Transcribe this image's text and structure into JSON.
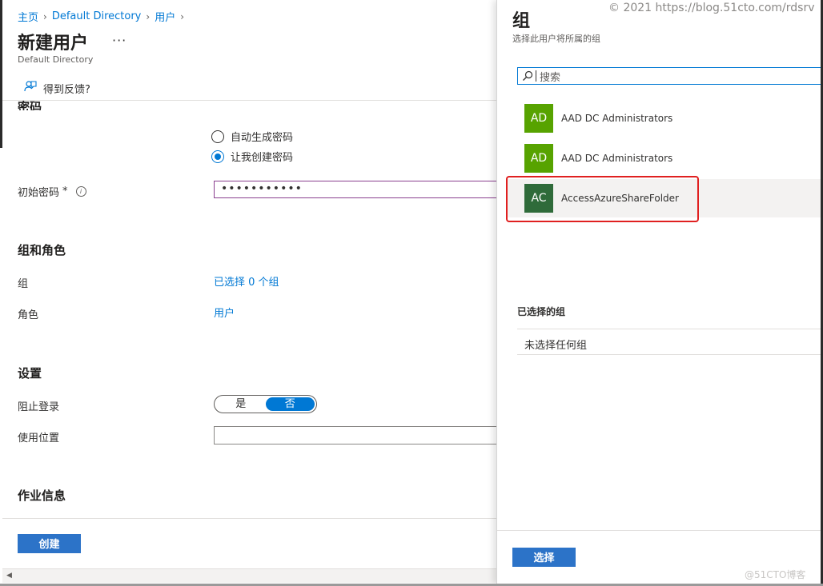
{
  "breadcrumb": [
    {
      "label": "主页"
    },
    {
      "label": "Default Directory"
    },
    {
      "label": "用户"
    }
  ],
  "page": {
    "title": "新建用户",
    "more": "···",
    "subtitle": "Default Directory",
    "feedback_label": "得到反馈?"
  },
  "password": {
    "section_title": "密码",
    "option_auto": "自动生成密码",
    "option_manual": "让我创建密码",
    "selected_option": "让我创建密码",
    "initial_label": "初始密码",
    "required_mark": "*",
    "initial_value": "•••••••••••"
  },
  "groups_roles": {
    "section_title": "组和角色",
    "groups_label": "组",
    "groups_value": "已选择 0 个组",
    "role_label": "角色",
    "role_value": "用户"
  },
  "settings": {
    "section_title": "设置",
    "block_signin_label": "阻止登录",
    "toggle_yes": "是",
    "toggle_no": "否",
    "toggle_selected": "否",
    "usage_location_label": "使用位置",
    "usage_location_value": ""
  },
  "job_info": {
    "section_title": "作业信息"
  },
  "footer": {
    "create_label": "创建"
  },
  "panel": {
    "title": "组",
    "subtitle": "选择此用户将所属的组",
    "search_placeholder": "搜索",
    "groups": [
      {
        "initials": "AD",
        "name": "AAD DC Administrators",
        "color": "#57a300"
      },
      {
        "initials": "AD",
        "name": "AAD DC Administrators",
        "color": "#57a300"
      },
      {
        "initials": "AC",
        "name": "AccessAzureShareFolder",
        "color": "#2f6b3a",
        "highlighted": true
      }
    ],
    "selected_title": "已选择的组",
    "selected_empty": "未选择任何组",
    "select_label": "选择"
  },
  "watermarks": {
    "top": "© 2021 https://blog.51cto.com/rdsrv",
    "bottom": "@51CTO博客"
  },
  "colors": {
    "accent": "#0078d4",
    "button": "#2c73c8",
    "highlight": "#e02020"
  }
}
